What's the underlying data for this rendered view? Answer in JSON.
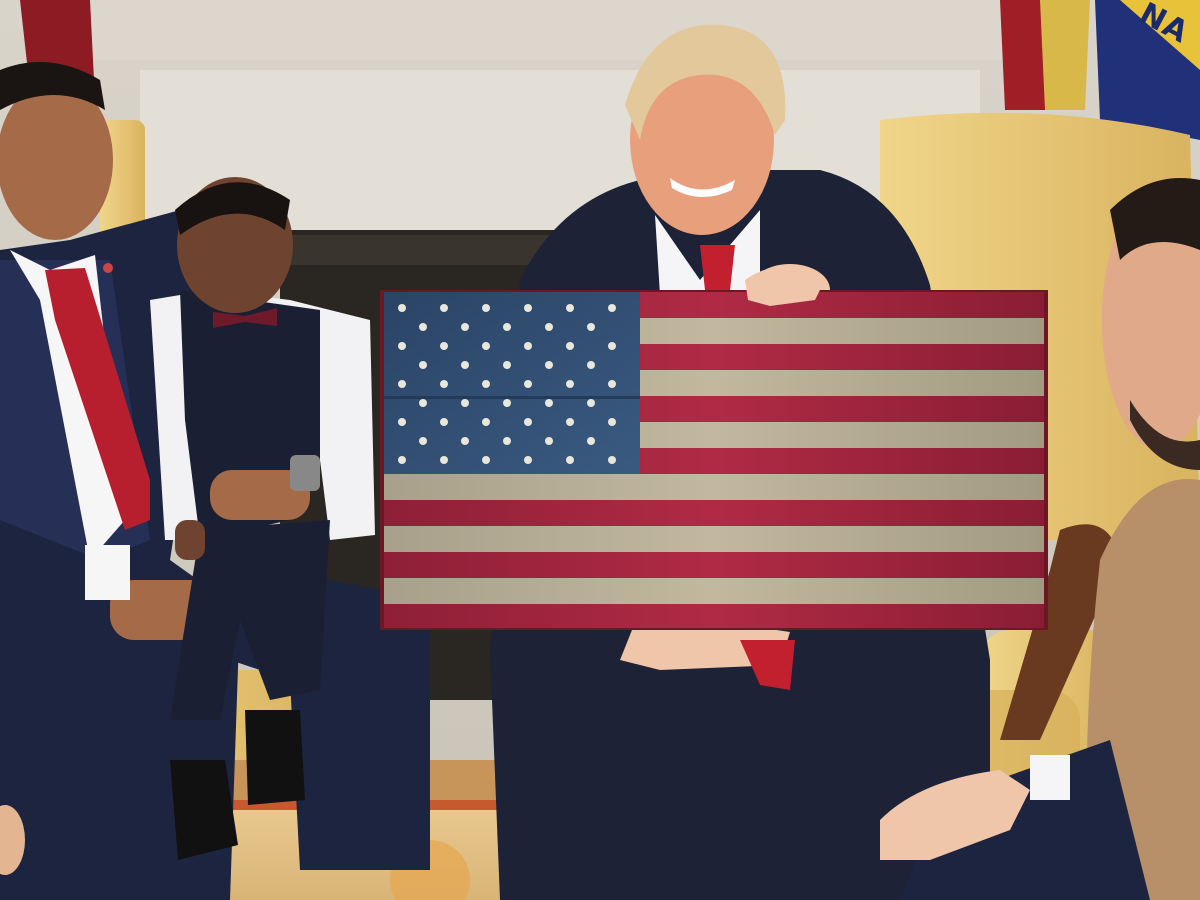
{
  "photo": {
    "background_flag_text": "NA",
    "colors": {
      "flag_red": "#a8243c",
      "flag_blue": "#2e4a6e",
      "flag_wood": "#b9ad95",
      "chair_gold": "#e8c978",
      "suit_navy": "#1c2440",
      "marble": "#e6e1d8"
    }
  }
}
